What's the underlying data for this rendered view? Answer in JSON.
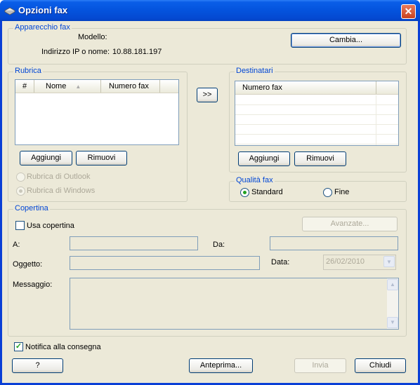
{
  "window": {
    "title": "Opzioni fax"
  },
  "device": {
    "group_label": "Apparecchio fax",
    "model_label": "Modello:",
    "model_value": "",
    "ip_label": "Indirizzo IP o nome:",
    "ip_value": "10.88.181.197",
    "change_button": "Cambia..."
  },
  "addressbook": {
    "group_label": "Rubrica",
    "columns": [
      "#",
      "Nome",
      "Numero fax"
    ],
    "add_button": "Aggiungi",
    "remove_button": "Rimuovi",
    "outlook_option": "Rubrica di Outlook",
    "windows_option": "Rubrica di Windows",
    "selected_source": "Rubrica di Windows"
  },
  "transfer_button": ">>",
  "recipients": {
    "group_label": "Destinatari",
    "columns": [
      "Numero fax"
    ],
    "add_button": "Aggiungi",
    "remove_button": "Rimuovi"
  },
  "quality": {
    "group_label": "Qualità fax",
    "standard_label": "Standard",
    "fine_label": "Fine",
    "selected": "Standard"
  },
  "cover": {
    "group_label": "Copertina",
    "use_cover_label": "Usa copertina",
    "use_cover_checked": false,
    "advanced_button": "Avanzate...",
    "to_label": "A:",
    "from_label": "Da:",
    "subject_label": "Oggetto:",
    "date_label": "Data:",
    "date_value": "26/02/2010",
    "message_label": "Messaggio:"
  },
  "notify": {
    "label": "Notifica alla consegna",
    "checked": true
  },
  "footer": {
    "help_button": "?",
    "preview_button": "Anteprima...",
    "send_button": "Invia",
    "close_button": "Chiudi"
  },
  "colors": {
    "titlebar": "#0453dd",
    "face": "#ece9d8",
    "group_label": "#0046d5"
  }
}
